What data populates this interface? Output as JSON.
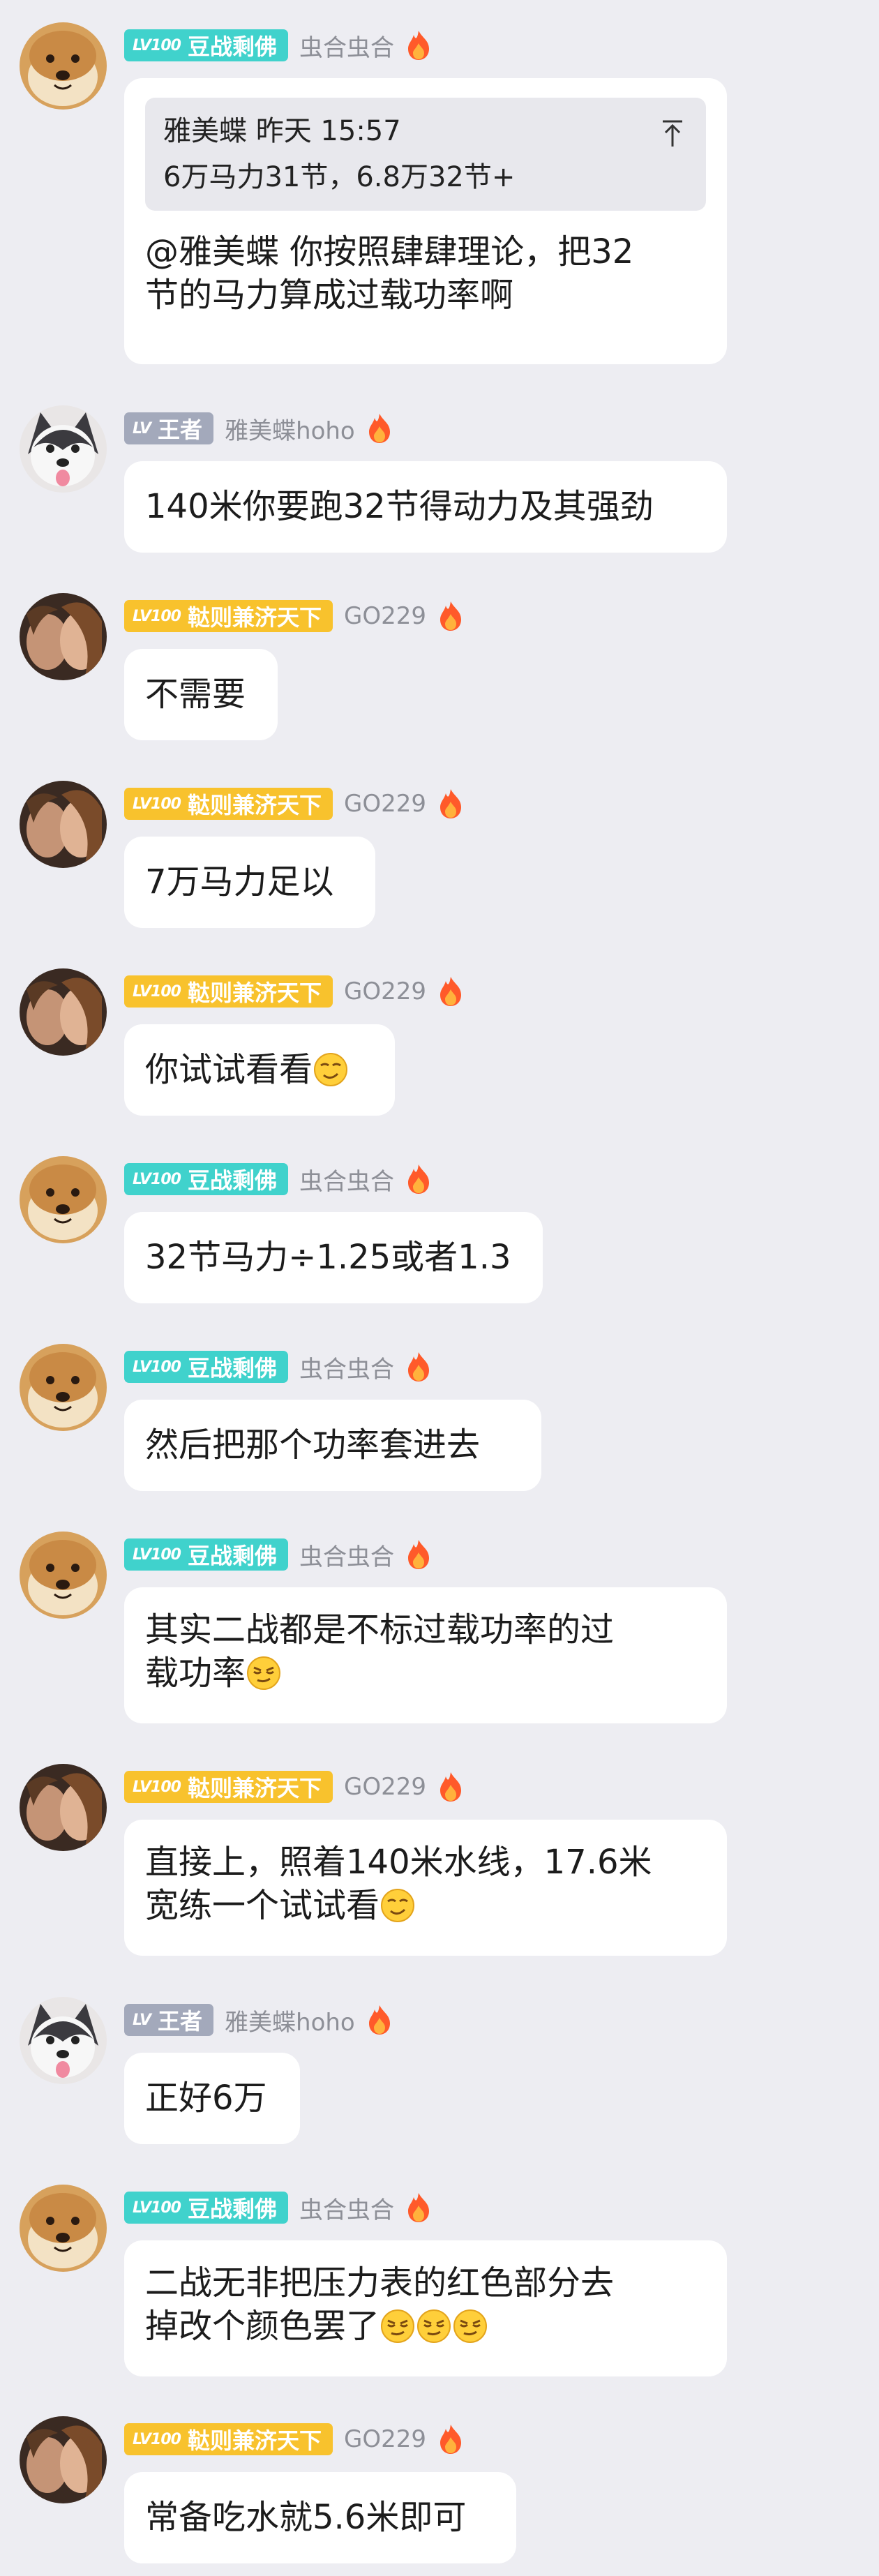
{
  "colors": {
    "background": "#ededf2",
    "badge_teal": "#40d2cc",
    "badge_gold": "#f8c22d",
    "badge_gray": "#a3a9bb",
    "bubble": "#ffffff",
    "quote_bg": "#e8e8ed"
  },
  "messages": [
    {
      "badge": {
        "level": "LV100",
        "title": "豆战剩佛",
        "color": "teal"
      },
      "nickname": "虫合虫合",
      "avatar": "shiba-dog-avatar",
      "quote": {
        "author": "雅美蝶",
        "time": "昨天 15:57",
        "text": "6万马力31节，6.8万32节+"
      },
      "lines": [
        "@雅美蝶 你按照肆肆理论，把32",
        "节的马力算成过载功率啊"
      ]
    },
    {
      "badge": {
        "level": "LV",
        "title": "王者",
        "color": "gray"
      },
      "nickname": "雅美蝶hoho",
      "avatar": "husky-dog-avatar",
      "lines": [
        "140米你要跑32节得动力及其强劲"
      ]
    },
    {
      "badge": {
        "level": "LV100",
        "title": "鞑则兼济天下",
        "color": "gold"
      },
      "nickname": "GO229",
      "avatar": "couple-photo-avatar",
      "lines": [
        "不需要"
      ]
    },
    {
      "badge": {
        "level": "LV100",
        "title": "鞑则兼济天下",
        "color": "gold"
      },
      "nickname": "GO229",
      "avatar": "couple-photo-avatar",
      "lines": [
        "7万马力足以"
      ]
    },
    {
      "badge": {
        "level": "LV100",
        "title": "鞑则兼济天下",
        "color": "gold"
      },
      "nickname": "GO229",
      "avatar": "couple-photo-avatar",
      "lines": [
        "你试试看看"
      ],
      "emoji": [
        "smirk-emoji"
      ]
    },
    {
      "badge": {
        "level": "LV100",
        "title": "豆战剩佛",
        "color": "teal"
      },
      "nickname": "虫合虫合",
      "avatar": "shiba-dog-avatar",
      "lines": [
        "32节马力÷1.25或者1.3"
      ]
    },
    {
      "badge": {
        "level": "LV100",
        "title": "豆战剩佛",
        "color": "teal"
      },
      "nickname": "虫合虫合",
      "avatar": "shiba-dog-avatar",
      "lines": [
        "然后把那个功率套进去"
      ]
    },
    {
      "badge": {
        "level": "LV100",
        "title": "豆战剩佛",
        "color": "teal"
      },
      "nickname": "虫合虫合",
      "avatar": "shiba-dog-avatar",
      "lines": [
        "其实二战都是不标过载功率的过",
        "载功率"
      ],
      "emoji": [
        "sly-emoji"
      ]
    },
    {
      "badge": {
        "level": "LV100",
        "title": "鞑则兼济天下",
        "color": "gold"
      },
      "nickname": "GO229",
      "avatar": "couple-photo-avatar",
      "lines": [
        "直接上，照着140米水线，17.6米",
        "宽练一个试试看"
      ],
      "emoji": [
        "smirk-emoji"
      ]
    },
    {
      "badge": {
        "level": "LV",
        "title": "王者",
        "color": "gray"
      },
      "nickname": "雅美蝶hoho",
      "avatar": "husky-dog-avatar",
      "lines": [
        "正好6万"
      ]
    },
    {
      "badge": {
        "level": "LV100",
        "title": "豆战剩佛",
        "color": "teal"
      },
      "nickname": "虫合虫合",
      "avatar": "shiba-dog-avatar",
      "lines": [
        "二战无非把压力表的红色部分去",
        "掉改个颜色罢了"
      ],
      "emoji": [
        "sly-emoji",
        "sly-emoji",
        "sly-emoji"
      ]
    },
    {
      "badge": {
        "level": "LV100",
        "title": "鞑则兼济天下",
        "color": "gold"
      },
      "nickname": "GO229",
      "avatar": "couple-photo-avatar",
      "lines": [
        "常备吃水就5.6米即可"
      ]
    }
  ]
}
